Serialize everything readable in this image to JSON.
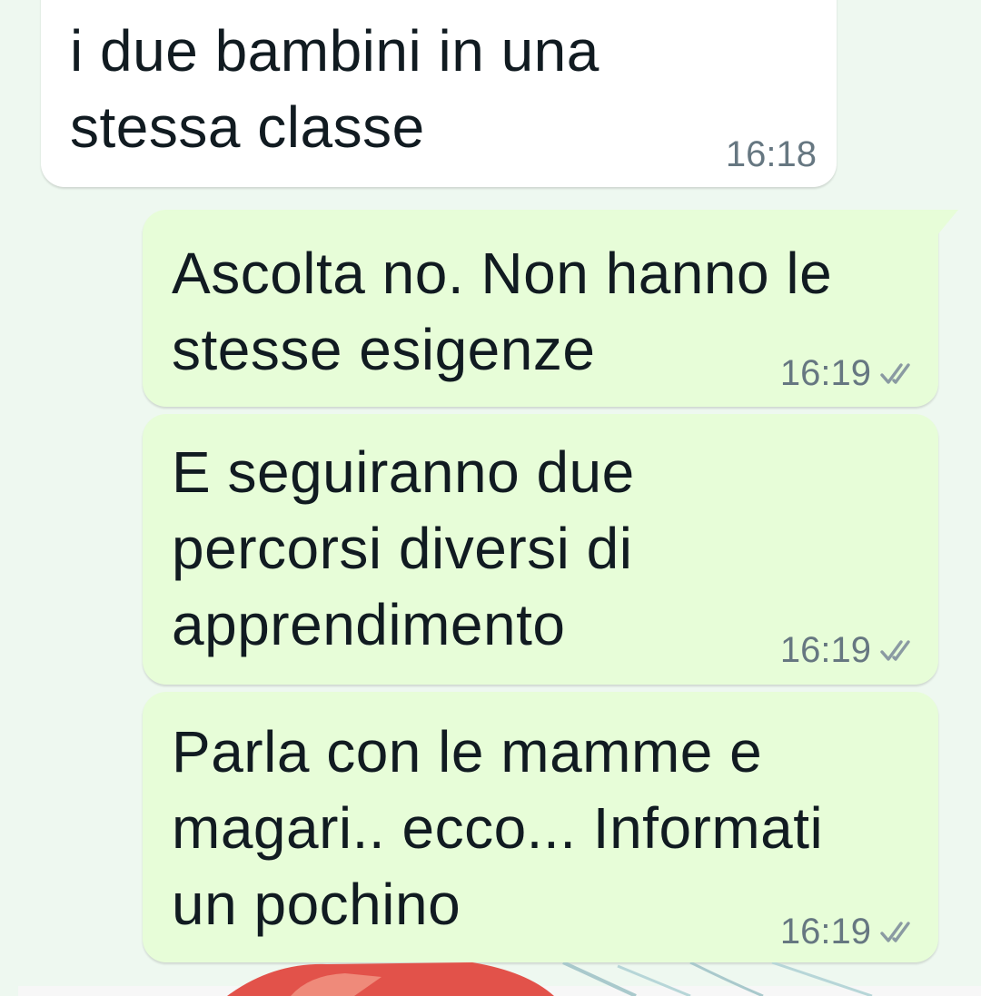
{
  "messages": [
    {
      "direction": "incoming",
      "lines": [
        "i due bambini in una",
        "stessa classe"
      ],
      "time": "16:18"
    },
    {
      "direction": "outgoing",
      "lines": [
        "Ascolta no. Non hanno le",
        "stesse esigenze"
      ],
      "time": "16:19",
      "status": "read-double-check-icon"
    },
    {
      "direction": "outgoing",
      "lines": [
        "E seguiranno due",
        "percorsi diversi di",
        "apprendimento"
      ],
      "time": "16:19",
      "status": "read-double-check-icon"
    },
    {
      "direction": "outgoing",
      "lines": [
        "Parla con le mamme e",
        "magari.. ecco... Informati",
        "un pochino"
      ],
      "time": "16:19",
      "status": "read-double-check-icon"
    }
  ],
  "colors": {
    "chat_background": "#eef8f0",
    "incoming_bubble": "#ffffff",
    "outgoing_bubble": "#e7fdd8",
    "timestamp": "#667781",
    "text": "#111b21"
  }
}
